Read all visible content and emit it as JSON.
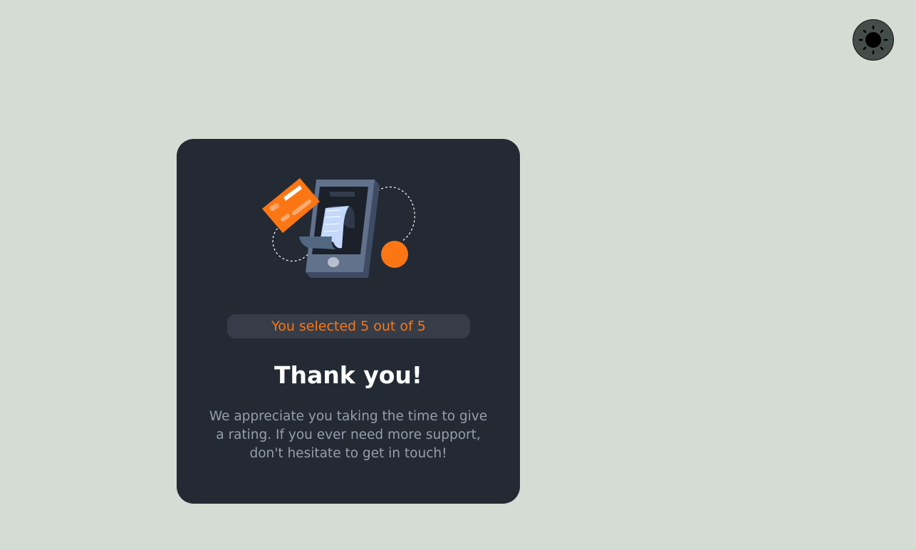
{
  "theme_toggle": {
    "icon": "sun-icon"
  },
  "card": {
    "illustration": "phone-payment-illustration",
    "selection_text": "You selected 5 out of 5",
    "title": "Thank you!",
    "description": "We appreciate you taking the time to give a rating. If you ever need more support, don't hesitate to get in touch!"
  },
  "colors": {
    "background": "#d5dcd4",
    "card": "#232a34",
    "accent": "#fc7614",
    "text_muted": "#959eac"
  }
}
